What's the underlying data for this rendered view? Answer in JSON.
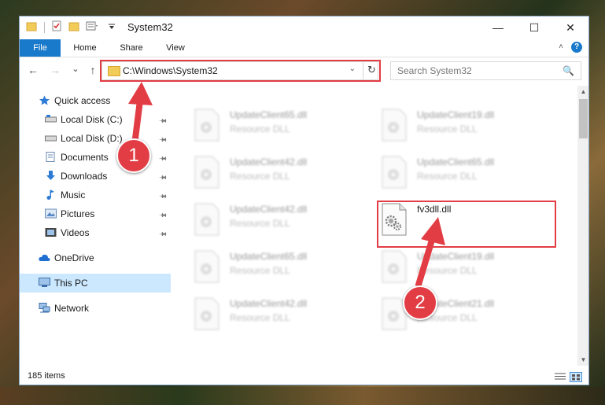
{
  "window": {
    "title": "System32",
    "minimize": "—",
    "maximize": "☐",
    "close": "✕"
  },
  "ribbon": {
    "tabs": [
      "File",
      "Home",
      "Share",
      "View"
    ],
    "help": "?",
    "collapse": "˄"
  },
  "nav": {
    "back": "←",
    "forward": "→",
    "recent": "⌄",
    "up": "↑",
    "address": "C:\\Windows\\System32",
    "address_dropdown": "⌄",
    "refresh": "↻",
    "search_placeholder": "Search System32"
  },
  "sidebar": {
    "items": [
      {
        "label": "Quick access"
      },
      {
        "label": "Local Disk (C:)"
      },
      {
        "label": "Local Disk (D:)"
      },
      {
        "label": "Documents"
      },
      {
        "label": "Downloads"
      },
      {
        "label": "Music"
      },
      {
        "label": "Pictures"
      },
      {
        "label": "Videos"
      },
      {
        "label": "OneDrive"
      },
      {
        "label": "This PC"
      },
      {
        "label": "Network"
      }
    ]
  },
  "files": [
    {
      "name": "UpdateClient65.dll",
      "type": "Resource DLL"
    },
    {
      "name": "UpdateClient19.dll",
      "type": "Resource DLL"
    },
    {
      "name": "UpdateClient42.dll",
      "type": "Resource DLL"
    },
    {
      "name": "UpdateClient65.dll",
      "type": "Resource DLL"
    },
    {
      "name": "UpdateClient42.dll",
      "type": "Resource DLL"
    },
    {
      "name": "fv3dll.dll",
      "type": ""
    },
    {
      "name": "UpdateClient65.dll",
      "type": "Resource DLL"
    },
    {
      "name": "UpdateClient19.dll",
      "type": "Resource DLL"
    },
    {
      "name": "UpdateClient42.dll",
      "type": "Resource DLL"
    },
    {
      "name": "UpdateClient21.dll",
      "type": "Resource DLL"
    }
  ],
  "status": {
    "count": "185 items"
  },
  "annotations": {
    "step1": "1",
    "step2": "2",
    "color": "#e23d44"
  }
}
